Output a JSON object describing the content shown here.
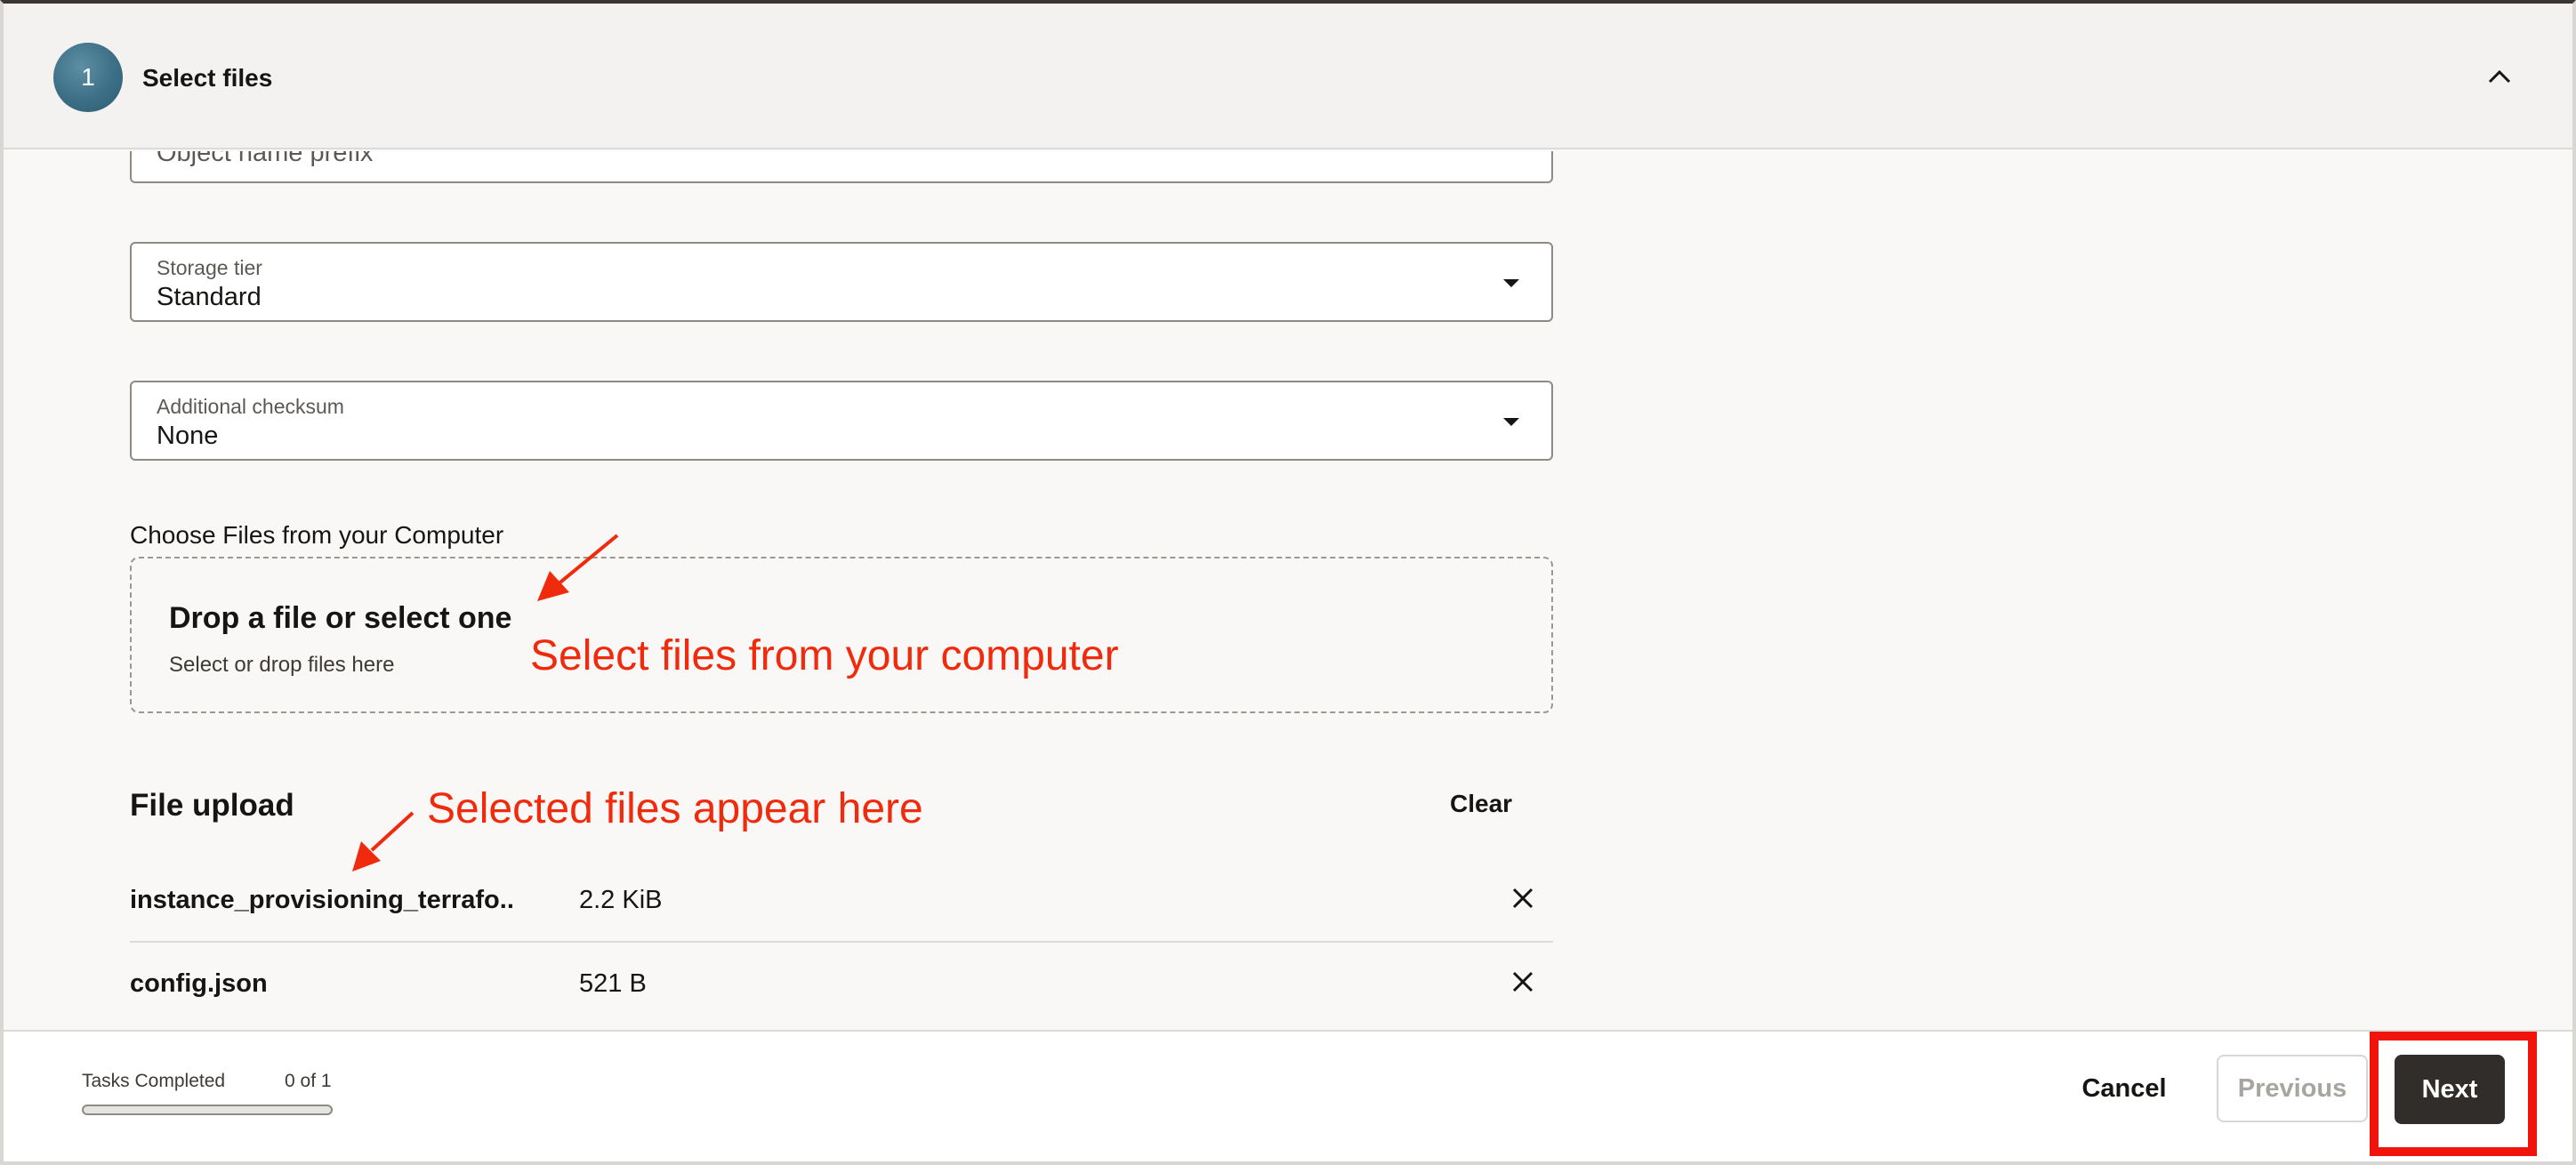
{
  "step": {
    "number": "1",
    "title": "Select files"
  },
  "form": {
    "prefix_placeholder": "Object name prefix",
    "storage_tier": {
      "label": "Storage tier",
      "value": "Standard"
    },
    "checksum": {
      "label": "Additional checksum",
      "value": "None"
    }
  },
  "dropzone": {
    "section_label": "Choose Files from your Computer",
    "title": "Drop a file or select one",
    "subtitle": "Select or drop files here"
  },
  "upload": {
    "title": "File upload",
    "clear_label": "Clear",
    "files": [
      {
        "name": "instance_provisioning_terrafo...",
        "size": "2.2 KiB"
      },
      {
        "name": "config.json",
        "size": "521 B"
      }
    ]
  },
  "annotations": {
    "select_files": "Select files from your computer",
    "selected_files": "Selected files appear here",
    "color": "#f02a0c"
  },
  "footer": {
    "tasks_label": "Tasks Completed",
    "tasks_count": "0 of 1",
    "progress_fraction": 0,
    "cancel_label": "Cancel",
    "previous_label": "Previous",
    "next_label": "Next"
  },
  "icons": {
    "collapse": "chevron-up-icon",
    "remove": "close-icon",
    "dropdown": "caret-down-icon"
  }
}
